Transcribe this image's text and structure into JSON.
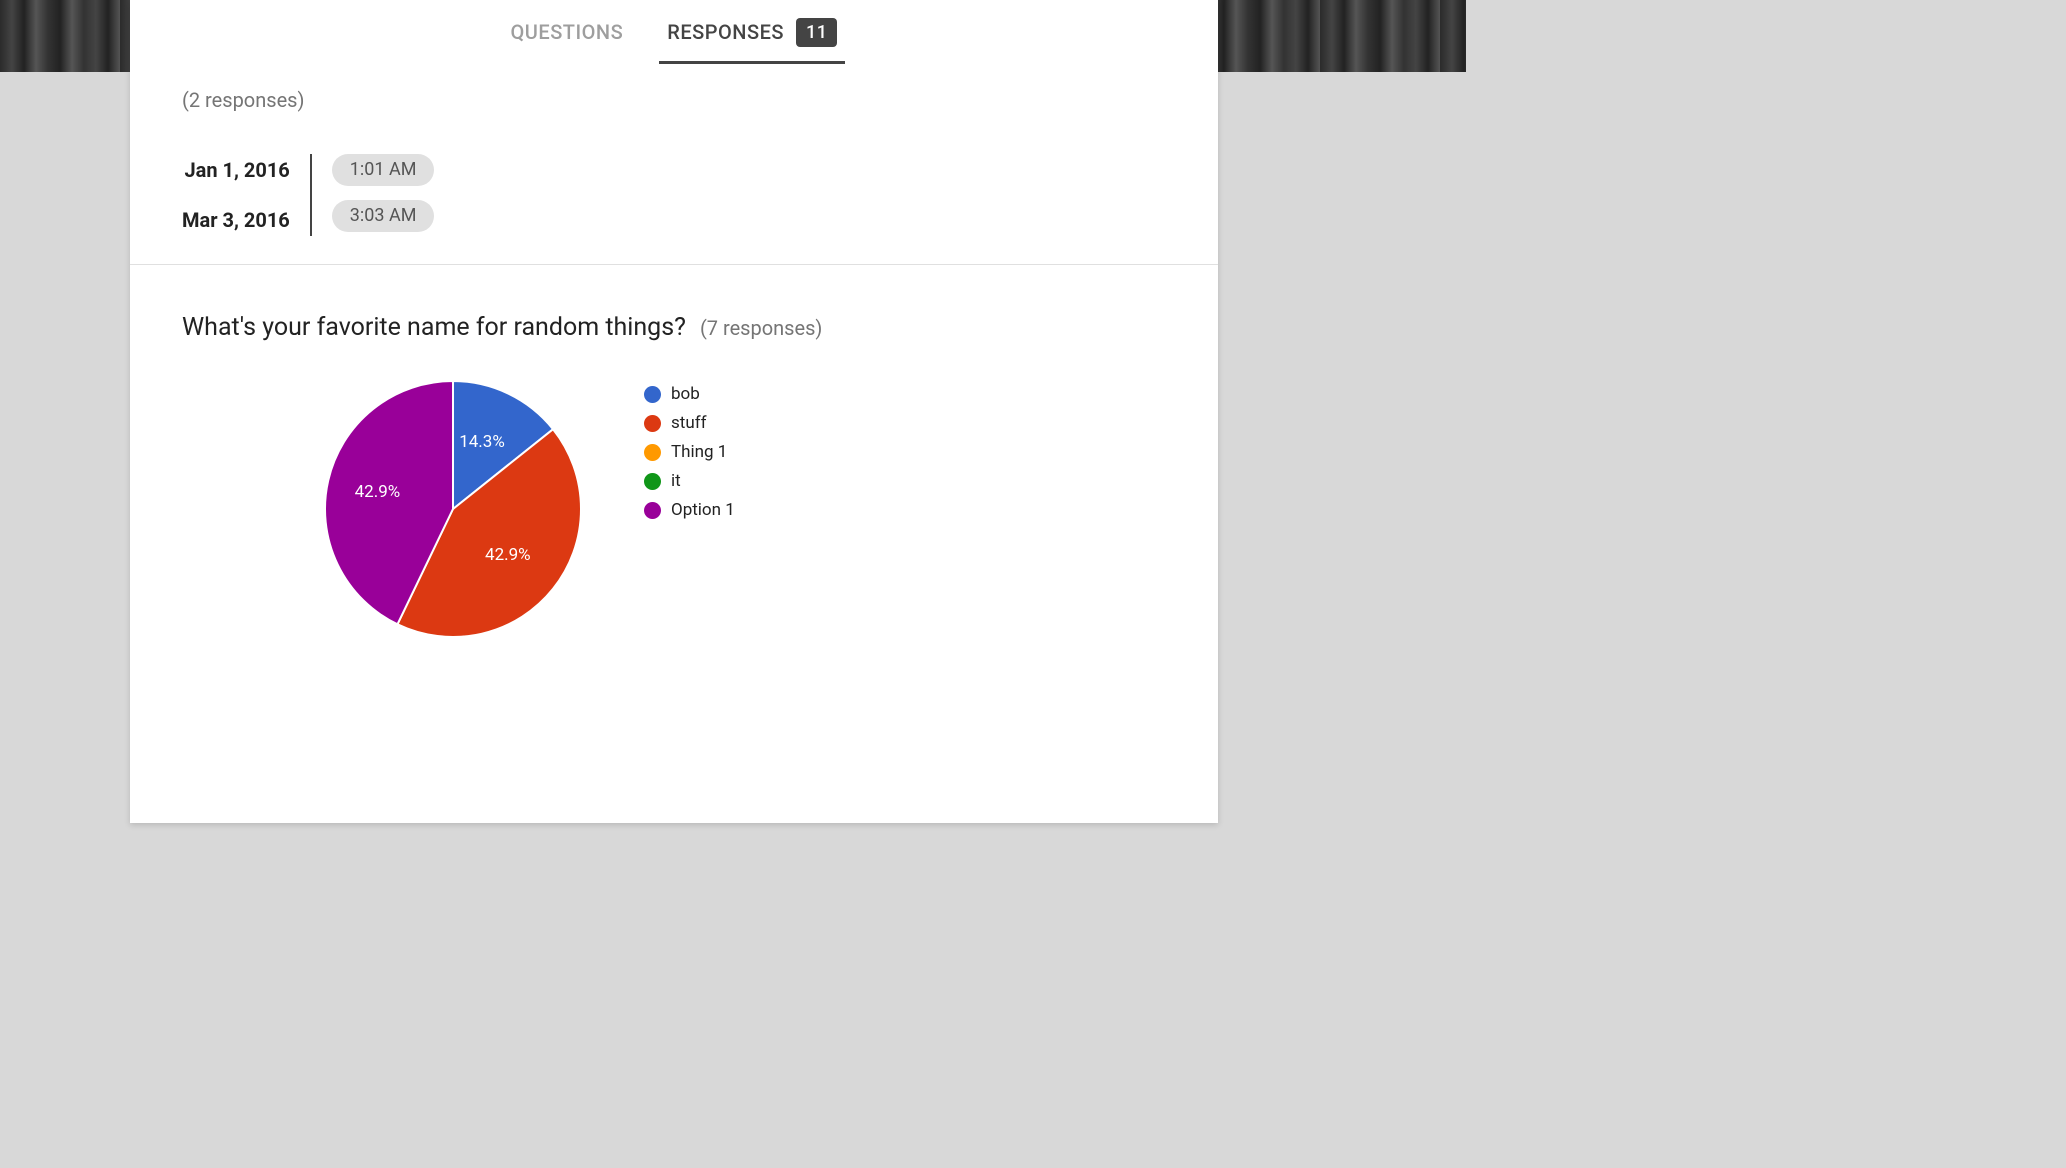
{
  "tabs": {
    "questions_label": "QUESTIONS",
    "responses_label": "RESPONSES",
    "responses_badge": "11"
  },
  "time_summary": {
    "count_text": "(2 responses)",
    "rows": [
      {
        "date": "Jan 1, 2016",
        "time": "1:01 AM"
      },
      {
        "date": "Mar 3, 2016",
        "time": "3:03 AM"
      }
    ]
  },
  "chart_section": {
    "question": "What's your favorite name for random things?",
    "count_text": "(7 responses)"
  },
  "chart_data": {
    "type": "pie",
    "title": "What's your favorite name for random things?",
    "series": [
      {
        "name": "bob",
        "value": 14.3,
        "color": "#3366cc"
      },
      {
        "name": "stuff",
        "value": 42.9,
        "color": "#dc3912"
      },
      {
        "name": "Thing 1",
        "value": 0.0,
        "color": "#ff9900"
      },
      {
        "name": "it",
        "value": 0.0,
        "color": "#109618"
      },
      {
        "name": "Option 1",
        "value": 42.9,
        "color": "#990099"
      }
    ],
    "labels_shown": [
      "14.3%",
      "42.9%",
      "42.9%"
    ]
  }
}
